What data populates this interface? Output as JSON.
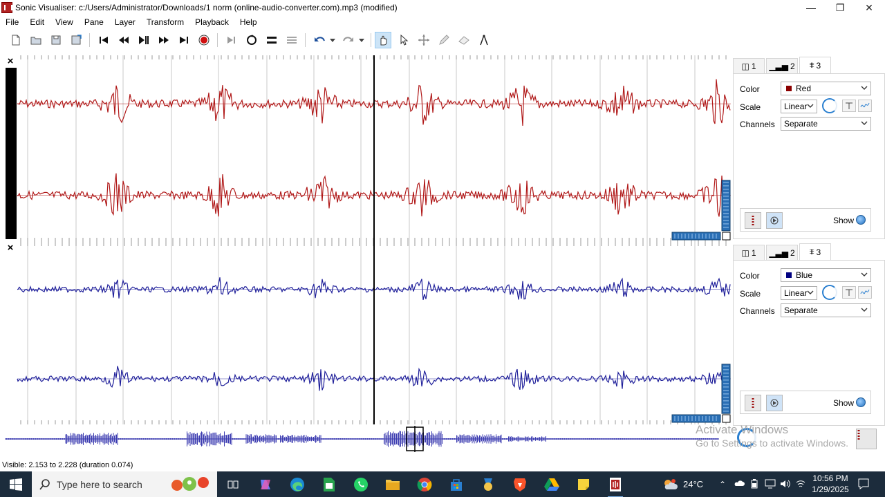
{
  "window": {
    "title": "Sonic Visualiser: c:/Users/Administrator/Downloads/1 norm (online-audio-converter.com).mp3 (modified)",
    "minimize_glyph": "—",
    "restore_glyph": "❐",
    "close_glyph": "✕"
  },
  "menu": [
    "File",
    "Edit",
    "View",
    "Pane",
    "Layer",
    "Transform",
    "Playback",
    "Help"
  ],
  "panes": [
    {
      "close_glyph": "×",
      "tabs": [
        {
          "label": "1"
        },
        {
          "label": "2"
        },
        {
          "label": "3"
        }
      ],
      "color_label": "Color",
      "color_value": "Red",
      "color_hex": "#8b0000",
      "scale_label": "Scale",
      "scale_value": "Linear",
      "channels_label": "Channels",
      "channels_value": "Separate",
      "show_label": "Show",
      "wave_color": "#b01818"
    },
    {
      "close_glyph": "×",
      "tabs": [
        {
          "label": "1"
        },
        {
          "label": "2"
        },
        {
          "label": "3"
        }
      ],
      "color_label": "Color",
      "color_value": "Blue",
      "color_hex": "#000080",
      "scale_label": "Scale",
      "scale_value": "Linear",
      "channels_label": "Channels",
      "channels_value": "Separate",
      "show_label": "Show",
      "wave_color": "#1f1f9a"
    }
  ],
  "overview": {
    "watermark_title": "Activate Windows",
    "watermark_sub": "Go to Settings to activate Windows."
  },
  "status": {
    "text": "Visible: 2.153 to 2.228 (duration 0.074)"
  },
  "taskbar": {
    "search_placeholder": "Type here to search",
    "temperature": "24°C",
    "time": "10:56 PM",
    "date": "1/29/2025"
  },
  "colors": {
    "accent": "#2a7fd0",
    "playhead": "#000000",
    "grid": "#c8c8c8",
    "taskbar": "#1c2c3c"
  }
}
